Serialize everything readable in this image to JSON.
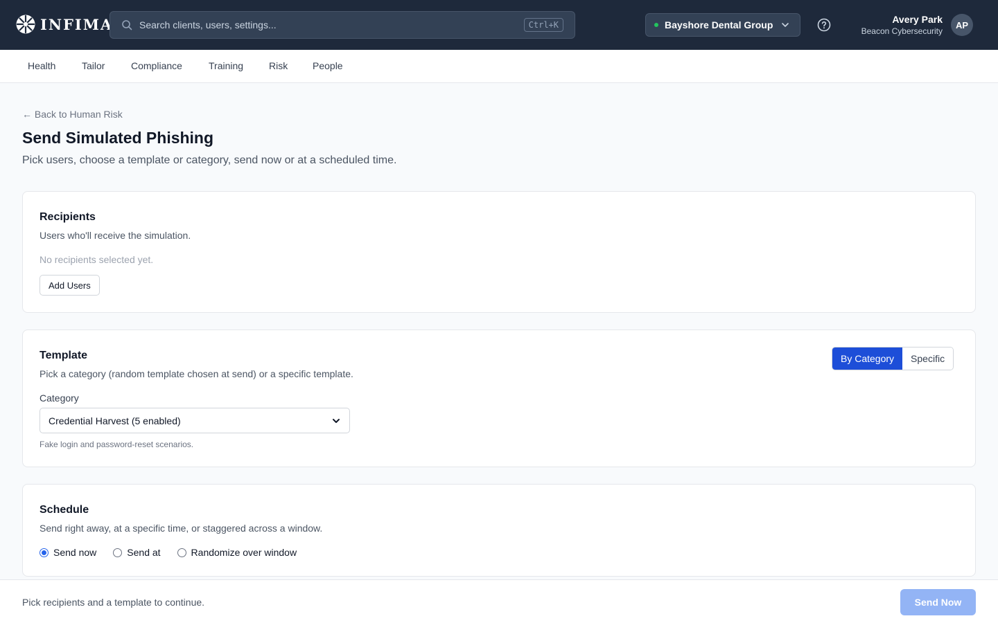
{
  "brand": {
    "name": "INFIMA"
  },
  "search": {
    "placeholder": "Search clients, users, settings...",
    "shortcut": "Ctrl+K"
  },
  "client_selector": {
    "selected": "Bayshore Dental Group",
    "status_color": "#22c55e"
  },
  "user": {
    "name": "Avery Park",
    "org": "Beacon Cybersecurity",
    "initials": "AP"
  },
  "nav": {
    "items": [
      "Health",
      "Tailor",
      "Compliance",
      "Training",
      "Risk",
      "People"
    ]
  },
  "breadcrumb": {
    "back_label": "← Back to Human Risk"
  },
  "page": {
    "title": "Send Simulated Phishing",
    "subtitle": "Pick users, choose a template or category, send now or at a scheduled time."
  },
  "recipients": {
    "title": "Recipients",
    "description": "Users who'll receive the simulation.",
    "empty_text": "No recipients selected yet.",
    "add_button": "Add Users"
  },
  "template": {
    "title": "Template",
    "description": "Pick a category (random template chosen at send) or a specific template.",
    "modes": [
      "By Category",
      "Specific"
    ],
    "active_mode": "By Category",
    "category_label": "Category",
    "category_value": "Credential Harvest (5 enabled)",
    "category_help": "Fake login and password-reset scenarios."
  },
  "schedule": {
    "title": "Schedule",
    "description": "Send right away, at a specific time, or staggered across a window.",
    "options": [
      "Send now",
      "Send at",
      "Randomize over window"
    ],
    "selected": "Send now"
  },
  "footer": {
    "hint": "Pick recipients and a template to continue.",
    "submit_label": "Send Now"
  },
  "colors": {
    "topbar": "#1e293b",
    "accent": "#1d4ed8",
    "disabled_primary": "#93b4f5"
  }
}
